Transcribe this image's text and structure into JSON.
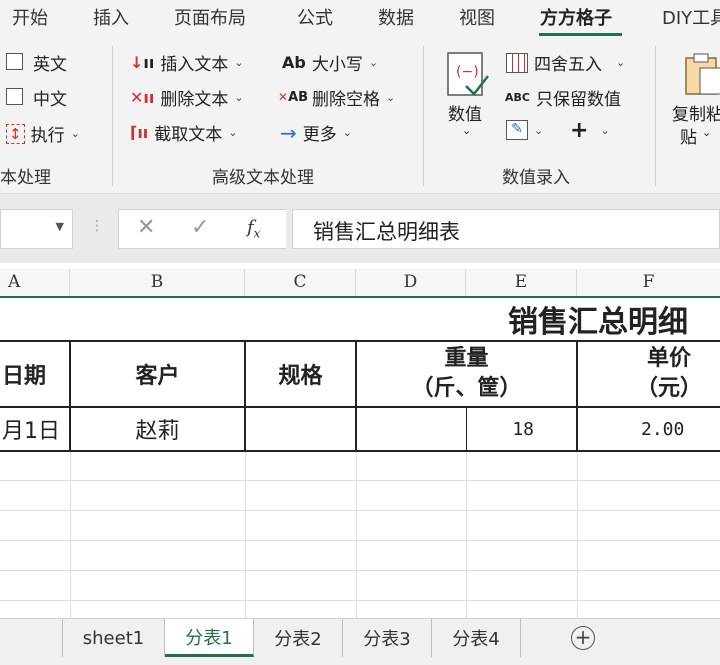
{
  "menu": {
    "tabs": [
      {
        "label": "开始"
      },
      {
        "label": "插入"
      },
      {
        "label": "页面布局"
      },
      {
        "label": "公式"
      },
      {
        "label": "数据"
      },
      {
        "label": "视图"
      },
      {
        "label": "方方格子"
      },
      {
        "label": "DIY工具"
      }
    ],
    "active": "方方格子"
  },
  "ribbon": {
    "text_group": {
      "english": "英文",
      "chinese": "中文",
      "execute": "执行",
      "label": "本处理"
    },
    "advanced_group": {
      "insert_text": "插入文本",
      "delete_text": "删除文本",
      "extract_text": "截取文本",
      "case": "大小写",
      "case_icon_text": "Ab",
      "delete_spaces": "删除空格",
      "delete_spaces_icon_text": "AB",
      "more": "更多",
      "label": "高级文本处理"
    },
    "number_group": {
      "value": "数值",
      "round": "四舍五入",
      "keep_numbers": "只保留数值",
      "keep_numbers_icon_text": "ABC",
      "label": "数值录入"
    },
    "copy_group": {
      "copy_paste_line1": "复制粘",
      "copy_paste_line2": "贴"
    }
  },
  "formula_bar": {
    "content": "销售汇总明细表"
  },
  "columns": [
    "A",
    "B",
    "C",
    "D",
    "E",
    "F"
  ],
  "table": {
    "title": "销售汇总明细",
    "headers": {
      "date": "日期",
      "customer": "客户",
      "spec": "规格",
      "weight_line1": "重量",
      "weight_line2": "（斤、筐）",
      "price_line1": "单价",
      "price_line2": "（元）"
    },
    "row1": {
      "date": "月1日",
      "customer": "赵莉",
      "weight": "18",
      "price": "2.00"
    }
  },
  "sheet_tabs": [
    {
      "label": "sheet1"
    },
    {
      "label": "分表1"
    },
    {
      "label": "分表2"
    },
    {
      "label": "分表3"
    },
    {
      "label": "分表4"
    }
  ],
  "active_sheet": "分表1",
  "colors": {
    "accent": "#217346",
    "red_icon": "#d03030",
    "blue_icon": "#2b6fd6"
  }
}
